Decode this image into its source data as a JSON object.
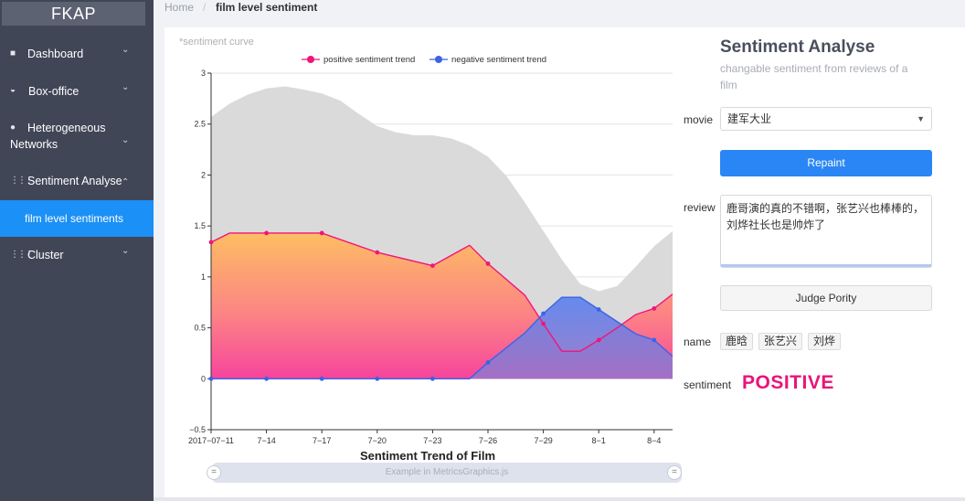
{
  "sidebar": {
    "logo": "FKAP",
    "items": [
      {
        "label": "Dashboard",
        "icon": "dashboard-icon",
        "glyph": "■",
        "caret": "⌄"
      },
      {
        "label": "Box-office",
        "icon": "pie-icon",
        "glyph": "◒",
        "caret": "⌄"
      },
      {
        "label": "Heterogeneous",
        "label2": "Networks",
        "icon": "network-icon",
        "glyph": "●",
        "caret": "⌄"
      },
      {
        "label": "Sentiment Analyse",
        "icon": "grid-icon",
        "glyph": "⋮⋮⋮",
        "caret": "⌃"
      },
      {
        "label": "Cluster",
        "icon": "grid-icon",
        "glyph": "⋮⋮⋮",
        "caret": "⌄"
      }
    ],
    "active_sub": "film level sentiments"
  },
  "breadcrumb": {
    "home": "Home",
    "sep": "/",
    "current": "film level sentiment"
  },
  "chart_caption": "*sentiment curve",
  "slider_text": "Example in MetricsGraphics.js",
  "panel": {
    "title": "Sentiment Analyse",
    "subtitle": "changable sentiment from reviews of a film",
    "movie_label": "movie",
    "movie_value": "建军大业",
    "repaint_label": "Repaint",
    "review_label": "review",
    "review_text": "鹿哥演的真的不错啊，张艺兴也棒棒的，刘烨社长也是帅炸了",
    "judge_label": "Judge Pority",
    "name_label": "name",
    "names": [
      "鹿晗",
      "张艺兴",
      "刘烨"
    ],
    "sentiment_label": "sentiment",
    "sentiment_value": "POSITIVE"
  },
  "colors": {
    "positive": "#f2147a",
    "negative": "#3b63e6",
    "active": "#1b90f6",
    "sidebar": "#414657"
  },
  "chart_data": {
    "type": "line",
    "title": "Sentiment Trend of Film",
    "ylim": [
      -0.5,
      3
    ],
    "yticks": [
      -0.5,
      0,
      0.5,
      1,
      1.5,
      2,
      2.5,
      3
    ],
    "ytick_labels": [
      "−0.5",
      "0",
      "0.5",
      "1",
      "1.5",
      "2",
      "2.5",
      "3"
    ],
    "xticks": [
      11,
      14,
      17,
      20,
      23,
      26,
      29,
      32,
      35
    ],
    "xtick_labels": [
      "2017−07−11",
      "7−14",
      "7−17",
      "7−20",
      "7−23",
      "7−26",
      "7−29",
      "8−1",
      "8−4"
    ],
    "xlim": [
      11,
      36
    ],
    "legend": [
      "positive sentiment trend",
      "negative sentiment trend"
    ],
    "series": [
      {
        "name": "positive sentiment trend",
        "x": [
          11,
          12,
          14,
          17,
          20,
          23,
          25,
          26,
          28,
          29,
          30,
          31,
          32,
          33,
          34,
          35,
          36
        ],
        "y": [
          1.34,
          1.43,
          1.43,
          1.43,
          1.24,
          1.11,
          1.31,
          1.13,
          0.82,
          0.54,
          0.27,
          0.27,
          0.38,
          0.5,
          0.63,
          0.69,
          0.83
        ],
        "markers": [
          11,
          14,
          17,
          20,
          23,
          26,
          29,
          32,
          35
        ]
      },
      {
        "name": "negative sentiment trend",
        "x": [
          11,
          14,
          17,
          20,
          23,
          25,
          26,
          28,
          29,
          30,
          31,
          32,
          33,
          34,
          35,
          36
        ],
        "y": [
          0,
          0,
          0,
          0,
          0,
          0,
          0.16,
          0.45,
          0.64,
          0.8,
          0.8,
          0.68,
          0.56,
          0.44,
          0.38,
          0.22
        ],
        "markers": [
          11,
          14,
          17,
          20,
          23,
          26,
          29,
          32,
          35
        ]
      },
      {
        "name": "",
        "x": [
          11,
          12,
          13,
          14,
          15,
          16,
          17,
          18,
          19,
          20,
          21,
          22,
          23,
          24,
          25,
          26,
          27,
          28,
          29,
          30,
          31,
          32,
          33,
          34,
          35,
          36
        ],
        "y": [
          2.57,
          2.7,
          2.79,
          2.85,
          2.87,
          2.84,
          2.8,
          2.73,
          2.6,
          2.48,
          2.42,
          2.39,
          2.39,
          2.36,
          2.29,
          2.18,
          1.99,
          1.73,
          1.45,
          1.17,
          0.93,
          0.86,
          0.91,
          1.1,
          1.3,
          1.45
        ]
      }
    ]
  }
}
